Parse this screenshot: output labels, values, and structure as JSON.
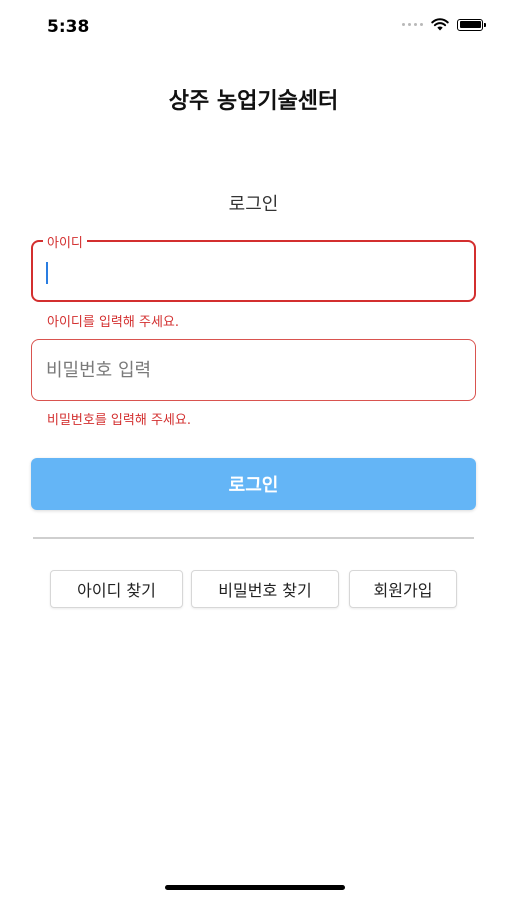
{
  "status_bar": {
    "time": "5:38"
  },
  "app_title": "상주 농업기술센터",
  "section_title": "로그인",
  "id_field": {
    "label": "아이디",
    "value": "",
    "error": "아이디를 입력해 주세요."
  },
  "password_field": {
    "placeholder": "비밀번호 입력",
    "value": "",
    "error": "비밀번호를 입력해 주세요."
  },
  "login_button": "로그인",
  "links": {
    "find_id": "아이디 찾기",
    "find_password": "비밀번호 찾기",
    "signup": "회원가입"
  },
  "colors": {
    "error": "#d32f2f",
    "primary_button": "#64b5f6",
    "divider": "#cfcfcf"
  },
  "icons": {
    "signal": "signal-dots-icon",
    "wifi": "wifi-icon",
    "battery": "battery-icon"
  }
}
